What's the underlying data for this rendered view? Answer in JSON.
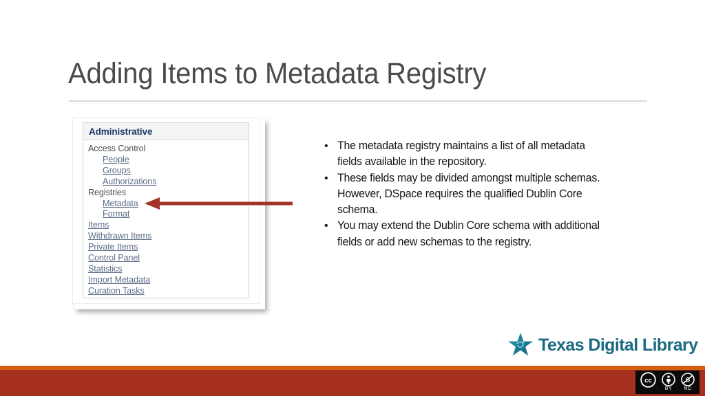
{
  "slide": {
    "title": "Adding Items to Metadata Registry"
  },
  "screenshot_panel": {
    "header": "Administrative",
    "items": [
      {
        "label": "Access Control",
        "type": "group",
        "indent": false
      },
      {
        "label": "People",
        "type": "link",
        "indent": true
      },
      {
        "label": "Groups",
        "type": "link",
        "indent": true
      },
      {
        "label": "Authorizations",
        "type": "link",
        "indent": true
      },
      {
        "label": "Registries",
        "type": "group",
        "indent": false
      },
      {
        "label": "Metadata",
        "type": "link",
        "indent": true
      },
      {
        "label": "Format",
        "type": "link",
        "indent": true
      },
      {
        "label": "Items",
        "type": "link",
        "indent": false
      },
      {
        "label": "Withdrawn Items",
        "type": "link",
        "indent": false
      },
      {
        "label": "Private Items",
        "type": "link",
        "indent": false
      },
      {
        "label": "Control Panel",
        "type": "link",
        "indent": false
      },
      {
        "label": "Statistics",
        "type": "link",
        "indent": false
      },
      {
        "label": "Import Metadata",
        "type": "link",
        "indent": false
      },
      {
        "label": "Curation Tasks",
        "type": "link",
        "indent": false
      }
    ]
  },
  "annotation": {
    "arrow_icon": "left-arrow-icon",
    "arrow_color": "#a13528",
    "points_to": "Metadata"
  },
  "bullets": [
    "The metadata registry maintains a list of all metadata fields available in the repository.",
    "These fields may be divided amongst multiple schemas. However, DSpace requires the qualified Dublin Core schema.",
    "You may extend the Dublin Core schema with additional fields or add new schemas to the registry."
  ],
  "bullet_marker": "•",
  "logo": {
    "icon": "star-icon",
    "text": "Texas Digital Library",
    "star_color": "#1f7f96",
    "text_color": "#1a6a80"
  },
  "license_badge": {
    "cc": "CC",
    "by_label": "BY",
    "nc_label": "NC"
  },
  "colors": {
    "band_orange": "#d4600f",
    "band_red": "#a6301e",
    "title_text": "#4a4a4a",
    "panel_header_text": "#1f3864",
    "link": "#5c6c88"
  }
}
